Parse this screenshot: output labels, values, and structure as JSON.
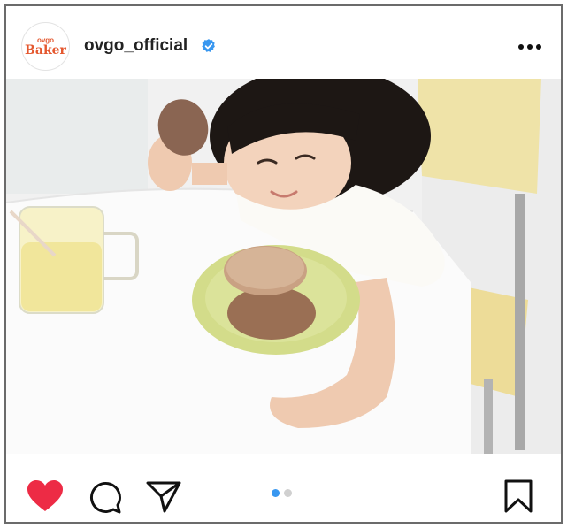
{
  "post": {
    "username": "ovgo_official",
    "avatar": {
      "top_text": "ovgo",
      "main_text": "Baker",
      "brand_color": "#e4572e"
    },
    "verified": true,
    "menu_icon": "more-horizontal-icon",
    "image_description": "",
    "carousel": {
      "count": 2,
      "active_index": 0
    },
    "actions": {
      "like": {
        "icon": "heart-icon",
        "liked": true,
        "color": "#ed2b45"
      },
      "comment": {
        "icon": "comment-icon"
      },
      "share": {
        "icon": "send-icon"
      },
      "save": {
        "icon": "bookmark-icon"
      }
    }
  }
}
